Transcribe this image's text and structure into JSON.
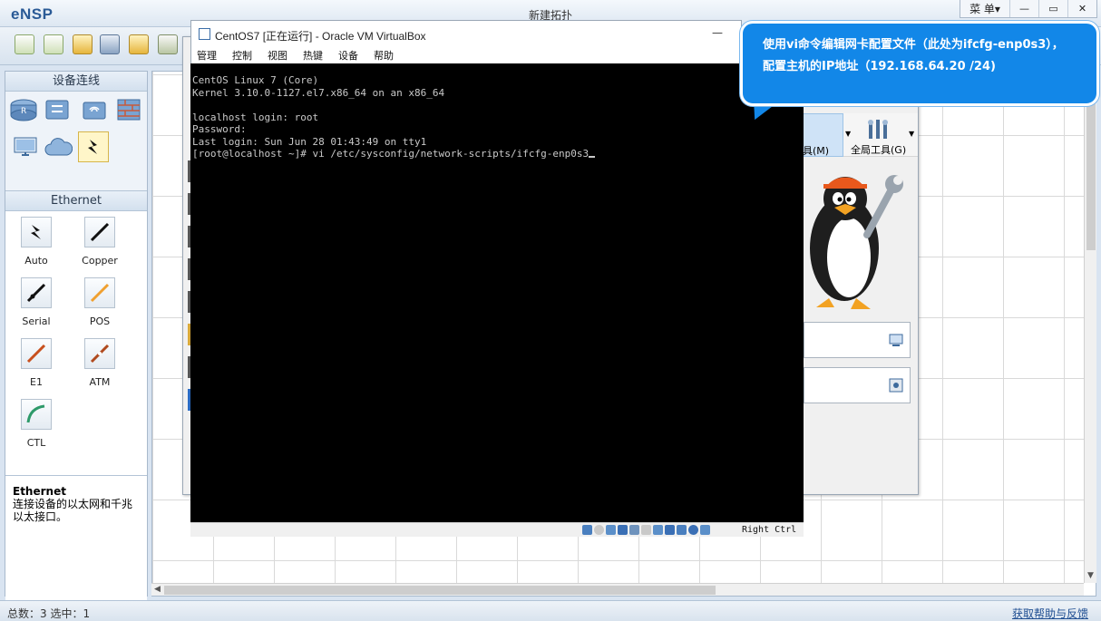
{
  "ensp": {
    "logo": "eNSP",
    "title": "新建拓扑",
    "menu_label": "菜 单▾",
    "min_icon": "minimize-icon",
    "max_icon": "maximize-icon",
    "close_icon": "close-icon"
  },
  "left_panel": {
    "device_header": "设备连线",
    "ethernet_header": "Ethernet",
    "cables": [
      {
        "label": "Auto",
        "color": "#111111"
      },
      {
        "label": "Copper",
        "color": "#111111"
      },
      {
        "label": "Serial",
        "color": "#111111"
      },
      {
        "label": "POS",
        "color": "#f0a030"
      },
      {
        "label": "E1",
        "color": "#c8501e"
      },
      {
        "label": "ATM",
        "color": "#b04a1e"
      },
      {
        "label": "CTL",
        "color": "#2e9a6a"
      }
    ],
    "description": {
      "title": "Ethernet",
      "text": "连接设备的以太网和千兆以太接口。"
    }
  },
  "status": {
    "total": "总数：3  选中：1",
    "help": "获取帮助与反馈"
  },
  "vm_window": {
    "title": "CentOS7 [正在运行] - Oracle VM VirtualBox",
    "min_label": "—",
    "menus": [
      "管理",
      "控制",
      "视图",
      "热键",
      "设备",
      "帮助"
    ],
    "console_lines": [
      "CentOS Linux 7 (Core)",
      "Kernel 3.10.0-1127.el7.x86_64 on an x86_64",
      "",
      "localhost login: root",
      "Password:",
      "Last login: Sun Jun 28 01:43:49 on tty1",
      "[root@localhost ~]# vi /etc/sysconfig/network-scripts/ifcfg-enp0s3"
    ],
    "host_key": "Right Ctrl"
  },
  "vbox_manager": {
    "tools_label_left": "具(M)",
    "tools_label": "全局工具(G)"
  },
  "tooltip": {
    "line1": "使用vi命令编辑网卡配置文件（此处为ifcfg-enp0s3），",
    "line2": "配置主机的IP地址（192.168.64.20 /24)"
  }
}
